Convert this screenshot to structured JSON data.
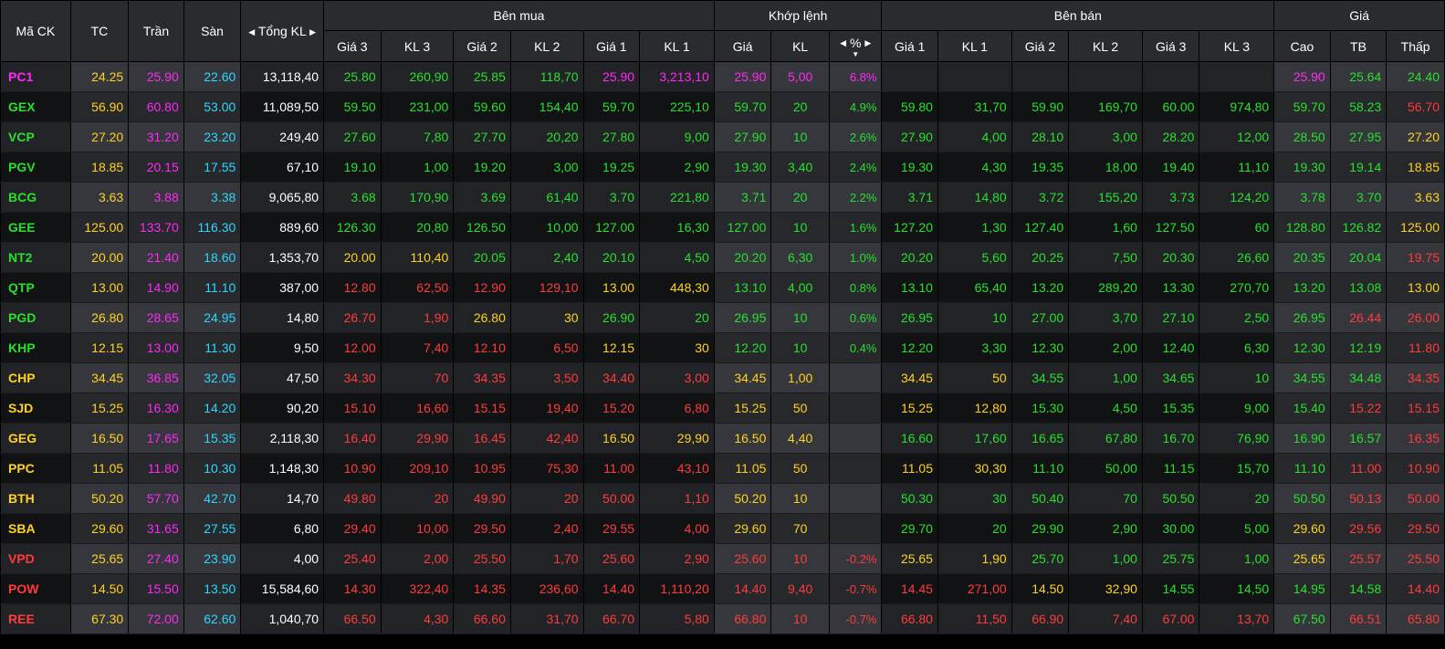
{
  "colors": {
    "up": "#28e02c",
    "down": "#ff3b3b",
    "reference": "#ffd21f",
    "ceiling": "#ff29f5",
    "floor": "#2ed7ff",
    "header_bg": "#2a2b2f"
  },
  "icons": {
    "prev": "◀",
    "next": "▶",
    "sort_desc": "▼",
    "prev_name": "triangle-left-icon",
    "next_name": "triangle-right-icon",
    "sort_name": "sort-desc-icon"
  },
  "header": {
    "symbol": "Mã CK",
    "ref": "TC",
    "ceil": "Trần",
    "floor": "Sàn",
    "total_vol": "Tổng KL",
    "groups": {
      "buy": "Bên mua",
      "match": "Khớp lệnh",
      "sell": "Bên bán",
      "price": "Giá"
    },
    "buy_cols": [
      "Giá 3",
      "KL 3",
      "Giá 2",
      "KL 2",
      "Giá 1",
      "KL 1"
    ],
    "match_cols": [
      "Giá",
      "KL",
      "%"
    ],
    "sell_cols": [
      "Giá 1",
      "KL 1",
      "Giá 2",
      "KL 2",
      "Giá 3",
      "KL 3"
    ],
    "price_cols": [
      "Cao",
      "TB",
      "Thấp"
    ]
  },
  "rows": [
    {
      "sym": "PC1",
      "ref": "24.25",
      "ceil": "25.90",
      "floor": "22.60",
      "total": "13,118,40",
      "b3p": "25.80",
      "b3v": "260,90",
      "b2p": "25.85",
      "b2v": "118,70",
      "b1p": "25.90",
      "b1v": "3,213,10",
      "mp": "25.90",
      "mv": "5,00",
      "pct": "6.8%",
      "s1p": "",
      "s1v": "",
      "s2p": "",
      "s2v": "",
      "s3p": "",
      "s3v": "",
      "hi": "25.90",
      "avg": "25.64",
      "lo": "24.40",
      "cls": {
        "sym": "ce",
        "b3p": "up",
        "b3v": "up",
        "b2p": "up",
        "b2v": "up",
        "b1p": "ce",
        "b1v": "ce",
        "mp": "ce",
        "mv": "ce",
        "pct": "ce",
        "s1p": "up",
        "s1v": "up",
        "s2p": "up",
        "s2v": "up",
        "s3p": "up",
        "s3v": "up",
        "hi": "ce",
        "avg": "up",
        "lo": "up"
      }
    },
    {
      "sym": "GEX",
      "ref": "56.90",
      "ceil": "60.80",
      "floor": "53.00",
      "total": "11,089,50",
      "b3p": "59.50",
      "b3v": "231,00",
      "b2p": "59.60",
      "b2v": "154,40",
      "b1p": "59.70",
      "b1v": "225,10",
      "mp": "59.70",
      "mv": "20",
      "pct": "4.9%",
      "s1p": "59.80",
      "s1v": "31,70",
      "s2p": "59.90",
      "s2v": "169,70",
      "s3p": "60.00",
      "s3v": "974,80",
      "hi": "59.70",
      "avg": "58.23",
      "lo": "56.70",
      "cls": {
        "sym": "up",
        "b3p": "up",
        "b3v": "up",
        "b2p": "up",
        "b2v": "up",
        "b1p": "up",
        "b1v": "up",
        "mp": "up",
        "mv": "up",
        "pct": "up",
        "s1p": "up",
        "s1v": "up",
        "s2p": "up",
        "s2v": "up",
        "s3p": "up",
        "s3v": "up",
        "hi": "up",
        "avg": "up",
        "lo": "dn"
      }
    },
    {
      "sym": "VCP",
      "ref": "27.20",
      "ceil": "31.20",
      "floor": "23.20",
      "total": "249,40",
      "b3p": "27.60",
      "b3v": "7,80",
      "b2p": "27.70",
      "b2v": "20,20",
      "b1p": "27.80",
      "b1v": "9,00",
      "mp": "27.90",
      "mv": "10",
      "pct": "2.6%",
      "s1p": "27.90",
      "s1v": "4,00",
      "s2p": "28.10",
      "s2v": "3,00",
      "s3p": "28.20",
      "s3v": "12,00",
      "hi": "28.50",
      "avg": "27.95",
      "lo": "27.20",
      "cls": {
        "sym": "up",
        "b3p": "up",
        "b3v": "up",
        "b2p": "up",
        "b2v": "up",
        "b1p": "up",
        "b1v": "up",
        "mp": "up",
        "mv": "up",
        "pct": "up",
        "s1p": "up",
        "s1v": "up",
        "s2p": "up",
        "s2v": "up",
        "s3p": "up",
        "s3v": "up",
        "hi": "up",
        "avg": "up",
        "lo": "ref"
      }
    },
    {
      "sym": "PGV",
      "ref": "18.85",
      "ceil": "20.15",
      "floor": "17.55",
      "total": "67,10",
      "b3p": "19.10",
      "b3v": "1,00",
      "b2p": "19.20",
      "b2v": "3,00",
      "b1p": "19.25",
      "b1v": "2,90",
      "mp": "19.30",
      "mv": "3,40",
      "pct": "2.4%",
      "s1p": "19.30",
      "s1v": "4,30",
      "s2p": "19.35",
      "s2v": "18,00",
      "s3p": "19.40",
      "s3v": "11,10",
      "hi": "19.30",
      "avg": "19.14",
      "lo": "18.85",
      "cls": {
        "sym": "up",
        "b3p": "up",
        "b3v": "up",
        "b2p": "up",
        "b2v": "up",
        "b1p": "up",
        "b1v": "up",
        "mp": "up",
        "mv": "up",
        "pct": "up",
        "s1p": "up",
        "s1v": "up",
        "s2p": "up",
        "s2v": "up",
        "s3p": "up",
        "s3v": "up",
        "hi": "up",
        "avg": "up",
        "lo": "ref"
      }
    },
    {
      "sym": "BCG",
      "ref": "3.63",
      "ceil": "3.88",
      "floor": "3.38",
      "total": "9,065,80",
      "b3p": "3.68",
      "b3v": "170,90",
      "b2p": "3.69",
      "b2v": "61,40",
      "b1p": "3.70",
      "b1v": "221,80",
      "mp": "3.71",
      "mv": "20",
      "pct": "2.2%",
      "s1p": "3.71",
      "s1v": "14,80",
      "s2p": "3.72",
      "s2v": "155,20",
      "s3p": "3.73",
      "s3v": "124,20",
      "hi": "3.78",
      "avg": "3.70",
      "lo": "3.63",
      "cls": {
        "sym": "up",
        "b3p": "up",
        "b3v": "up",
        "b2p": "up",
        "b2v": "up",
        "b1p": "up",
        "b1v": "up",
        "mp": "up",
        "mv": "up",
        "pct": "up",
        "s1p": "up",
        "s1v": "up",
        "s2p": "up",
        "s2v": "up",
        "s3p": "up",
        "s3v": "up",
        "hi": "up",
        "avg": "up",
        "lo": "ref"
      }
    },
    {
      "sym": "GEE",
      "ref": "125.00",
      "ceil": "133.70",
      "floor": "116.30",
      "total": "889,60",
      "b3p": "126.30",
      "b3v": "20,80",
      "b2p": "126.50",
      "b2v": "10,00",
      "b1p": "127.00",
      "b1v": "16,30",
      "mp": "127.00",
      "mv": "10",
      "pct": "1.6%",
      "s1p": "127.20",
      "s1v": "1,30",
      "s2p": "127.40",
      "s2v": "1,60",
      "s3p": "127.50",
      "s3v": "60",
      "hi": "128.80",
      "avg": "126.82",
      "lo": "125.00",
      "cls": {
        "sym": "up",
        "b3p": "up",
        "b3v": "up",
        "b2p": "up",
        "b2v": "up",
        "b1p": "up",
        "b1v": "up",
        "mp": "up",
        "mv": "up",
        "pct": "up",
        "s1p": "up",
        "s1v": "up",
        "s2p": "up",
        "s2v": "up",
        "s3p": "up",
        "s3v": "up",
        "hi": "up",
        "avg": "up",
        "lo": "ref"
      }
    },
    {
      "sym": "NT2",
      "ref": "20.00",
      "ceil": "21.40",
      "floor": "18.60",
      "total": "1,353,70",
      "b3p": "20.00",
      "b3v": "110,40",
      "b2p": "20.05",
      "b2v": "2,40",
      "b1p": "20.10",
      "b1v": "4,50",
      "mp": "20.20",
      "mv": "6,30",
      "pct": "1.0%",
      "s1p": "20.20",
      "s1v": "5,60",
      "s2p": "20.25",
      "s2v": "7,50",
      "s3p": "20.30",
      "s3v": "26,60",
      "hi": "20.35",
      "avg": "20.04",
      "lo": "19.75",
      "cls": {
        "sym": "up",
        "b3p": "ref",
        "b3v": "ref",
        "b2p": "up",
        "b2v": "up",
        "b1p": "up",
        "b1v": "up",
        "mp": "up",
        "mv": "up",
        "pct": "up",
        "s1p": "up",
        "s1v": "up",
        "s2p": "up",
        "s2v": "up",
        "s3p": "up",
        "s3v": "up",
        "hi": "up",
        "avg": "up",
        "lo": "dn"
      }
    },
    {
      "sym": "QTP",
      "ref": "13.00",
      "ceil": "14.90",
      "floor": "11.10",
      "total": "387,00",
      "b3p": "12.80",
      "b3v": "62,50",
      "b2p": "12.90",
      "b2v": "129,10",
      "b1p": "13.00",
      "b1v": "448,30",
      "mp": "13.10",
      "mv": "4,00",
      "pct": "0.8%",
      "s1p": "13.10",
      "s1v": "65,40",
      "s2p": "13.20",
      "s2v": "289,20",
      "s3p": "13.30",
      "s3v": "270,70",
      "hi": "13.20",
      "avg": "13.08",
      "lo": "13.00",
      "cls": {
        "sym": "up",
        "b3p": "dn",
        "b3v": "dn",
        "b2p": "dn",
        "b2v": "dn",
        "b1p": "ref",
        "b1v": "ref",
        "mp": "up",
        "mv": "up",
        "pct": "up",
        "s1p": "up",
        "s1v": "up",
        "s2p": "up",
        "s2v": "up",
        "s3p": "up",
        "s3v": "up",
        "hi": "up",
        "avg": "up",
        "lo": "ref"
      }
    },
    {
      "sym": "PGD",
      "ref": "26.80",
      "ceil": "28.65",
      "floor": "24.95",
      "total": "14,80",
      "b3p": "26.70",
      "b3v": "1,90",
      "b2p": "26.80",
      "b2v": "30",
      "b1p": "26.90",
      "b1v": "20",
      "mp": "26.95",
      "mv": "10",
      "pct": "0.6%",
      "s1p": "26.95",
      "s1v": "10",
      "s2p": "27.00",
      "s2v": "3,70",
      "s3p": "27.10",
      "s3v": "2,50",
      "hi": "26.95",
      "avg": "26.44",
      "lo": "26.00",
      "cls": {
        "sym": "up",
        "b3p": "dn",
        "b3v": "dn",
        "b2p": "ref",
        "b2v": "ref",
        "b1p": "up",
        "b1v": "up",
        "mp": "up",
        "mv": "up",
        "pct": "up",
        "s1p": "up",
        "s1v": "up",
        "s2p": "up",
        "s2v": "up",
        "s3p": "up",
        "s3v": "up",
        "hi": "up",
        "avg": "dn",
        "lo": "dn"
      }
    },
    {
      "sym": "KHP",
      "ref": "12.15",
      "ceil": "13.00",
      "floor": "11.30",
      "total": "9,50",
      "b3p": "12.00",
      "b3v": "7,40",
      "b2p": "12.10",
      "b2v": "6,50",
      "b1p": "12.15",
      "b1v": "30",
      "mp": "12.20",
      "mv": "10",
      "pct": "0.4%",
      "s1p": "12.20",
      "s1v": "3,30",
      "s2p": "12.30",
      "s2v": "2,00",
      "s3p": "12.40",
      "s3v": "6,30",
      "hi": "12.30",
      "avg": "12.19",
      "lo": "11.80",
      "cls": {
        "sym": "up",
        "b3p": "dn",
        "b3v": "dn",
        "b2p": "dn",
        "b2v": "dn",
        "b1p": "ref",
        "b1v": "ref",
        "mp": "up",
        "mv": "up",
        "pct": "up",
        "s1p": "up",
        "s1v": "up",
        "s2p": "up",
        "s2v": "up",
        "s3p": "up",
        "s3v": "up",
        "hi": "up",
        "avg": "up",
        "lo": "dn"
      }
    },
    {
      "sym": "CHP",
      "ref": "34.45",
      "ceil": "36.85",
      "floor": "32.05",
      "total": "47,50",
      "b3p": "34.30",
      "b3v": "70",
      "b2p": "34.35",
      "b2v": "3,50",
      "b1p": "34.40",
      "b1v": "3,00",
      "mp": "34.45",
      "mv": "1,00",
      "pct": "",
      "s1p": "34.45",
      "s1v": "50",
      "s2p": "34.55",
      "s2v": "1,00",
      "s3p": "34.65",
      "s3v": "10",
      "hi": "34.55",
      "avg": "34.48",
      "lo": "34.35",
      "cls": {
        "sym": "ref",
        "b3p": "dn",
        "b3v": "dn",
        "b2p": "dn",
        "b2v": "dn",
        "b1p": "dn",
        "b1v": "dn",
        "mp": "ref",
        "mv": "ref",
        "pct": "ref",
        "s1p": "ref",
        "s1v": "ref",
        "s2p": "up",
        "s2v": "up",
        "s3p": "up",
        "s3v": "up",
        "hi": "up",
        "avg": "up",
        "lo": "dn"
      }
    },
    {
      "sym": "SJD",
      "ref": "15.25",
      "ceil": "16.30",
      "floor": "14.20",
      "total": "90,20",
      "b3p": "15.10",
      "b3v": "16,60",
      "b2p": "15.15",
      "b2v": "19,40",
      "b1p": "15.20",
      "b1v": "6,80",
      "mp": "15.25",
      "mv": "50",
      "pct": "",
      "s1p": "15.25",
      "s1v": "12,80",
      "s2p": "15.30",
      "s2v": "4,50",
      "s3p": "15.35",
      "s3v": "9,00",
      "hi": "15.40",
      "avg": "15.22",
      "lo": "15.15",
      "cls": {
        "sym": "ref",
        "b3p": "dn",
        "b3v": "dn",
        "b2p": "dn",
        "b2v": "dn",
        "b1p": "dn",
        "b1v": "dn",
        "mp": "ref",
        "mv": "ref",
        "pct": "ref",
        "s1p": "ref",
        "s1v": "ref",
        "s2p": "up",
        "s2v": "up",
        "s3p": "up",
        "s3v": "up",
        "hi": "up",
        "avg": "dn",
        "lo": "dn"
      }
    },
    {
      "sym": "GEG",
      "ref": "16.50",
      "ceil": "17.65",
      "floor": "15.35",
      "total": "2,118,30",
      "b3p": "16.40",
      "b3v": "29,90",
      "b2p": "16.45",
      "b2v": "42,40",
      "b1p": "16.50",
      "b1v": "29,90",
      "mp": "16.50",
      "mv": "4,40",
      "pct": "",
      "s1p": "16.60",
      "s1v": "17,60",
      "s2p": "16.65",
      "s2v": "67,80",
      "s3p": "16.70",
      "s3v": "76,90",
      "hi": "16.90",
      "avg": "16.57",
      "lo": "16.35",
      "cls": {
        "sym": "ref",
        "b3p": "dn",
        "b3v": "dn",
        "b2p": "dn",
        "b2v": "dn",
        "b1p": "ref",
        "b1v": "ref",
        "mp": "ref",
        "mv": "ref",
        "pct": "ref",
        "s1p": "up",
        "s1v": "up",
        "s2p": "up",
        "s2v": "up",
        "s3p": "up",
        "s3v": "up",
        "hi": "up",
        "avg": "up",
        "lo": "dn"
      }
    },
    {
      "sym": "PPC",
      "ref": "11.05",
      "ceil": "11.80",
      "floor": "10.30",
      "total": "1,148,30",
      "b3p": "10.90",
      "b3v": "209,10",
      "b2p": "10.95",
      "b2v": "75,30",
      "b1p": "11.00",
      "b1v": "43,10",
      "mp": "11.05",
      "mv": "50",
      "pct": "",
      "s1p": "11.05",
      "s1v": "30,30",
      "s2p": "11.10",
      "s2v": "50,00",
      "s3p": "11.15",
      "s3v": "15,70",
      "hi": "11.10",
      "avg": "11.00",
      "lo": "10.90",
      "cls": {
        "sym": "ref",
        "b3p": "dn",
        "b3v": "dn",
        "b2p": "dn",
        "b2v": "dn",
        "b1p": "dn",
        "b1v": "dn",
        "mp": "ref",
        "mv": "ref",
        "pct": "ref",
        "s1p": "ref",
        "s1v": "ref",
        "s2p": "up",
        "s2v": "up",
        "s3p": "up",
        "s3v": "up",
        "hi": "up",
        "avg": "dn",
        "lo": "dn"
      }
    },
    {
      "sym": "BTH",
      "ref": "50.20",
      "ceil": "57.70",
      "floor": "42.70",
      "total": "14,70",
      "b3p": "49.80",
      "b3v": "20",
      "b2p": "49.90",
      "b2v": "20",
      "b1p": "50.00",
      "b1v": "1,10",
      "mp": "50.20",
      "mv": "10",
      "pct": "",
      "s1p": "50.30",
      "s1v": "30",
      "s2p": "50.40",
      "s2v": "70",
      "s3p": "50.50",
      "s3v": "20",
      "hi": "50.50",
      "avg": "50.13",
      "lo": "50.00",
      "cls": {
        "sym": "ref",
        "b3p": "dn",
        "b3v": "dn",
        "b2p": "dn",
        "b2v": "dn",
        "b1p": "dn",
        "b1v": "dn",
        "mp": "ref",
        "mv": "ref",
        "pct": "ref",
        "s1p": "up",
        "s1v": "up",
        "s2p": "up",
        "s2v": "up",
        "s3p": "up",
        "s3v": "up",
        "hi": "up",
        "avg": "dn",
        "lo": "dn"
      }
    },
    {
      "sym": "SBA",
      "ref": "29.60",
      "ceil": "31.65",
      "floor": "27.55",
      "total": "6,80",
      "b3p": "29.40",
      "b3v": "10,00",
      "b2p": "29.50",
      "b2v": "2,40",
      "b1p": "29.55",
      "b1v": "4,00",
      "mp": "29.60",
      "mv": "70",
      "pct": "",
      "s1p": "29.70",
      "s1v": "20",
      "s2p": "29.90",
      "s2v": "2,90",
      "s3p": "30.00",
      "s3v": "5,00",
      "hi": "29.60",
      "avg": "29.56",
      "lo": "29.50",
      "cls": {
        "sym": "ref",
        "b3p": "dn",
        "b3v": "dn",
        "b2p": "dn",
        "b2v": "dn",
        "b1p": "dn",
        "b1v": "dn",
        "mp": "ref",
        "mv": "ref",
        "pct": "ref",
        "s1p": "up",
        "s1v": "up",
        "s2p": "up",
        "s2v": "up",
        "s3p": "up",
        "s3v": "up",
        "hi": "ref",
        "avg": "dn",
        "lo": "dn"
      }
    },
    {
      "sym": "VPD",
      "ref": "25.65",
      "ceil": "27.40",
      "floor": "23.90",
      "total": "4,00",
      "b3p": "25.40",
      "b3v": "2,00",
      "b2p": "25.50",
      "b2v": "1,70",
      "b1p": "25.60",
      "b1v": "2,90",
      "mp": "25.60",
      "mv": "10",
      "pct": "-0.2%",
      "s1p": "25.65",
      "s1v": "1,90",
      "s2p": "25.70",
      "s2v": "1,00",
      "s3p": "25.75",
      "s3v": "1,00",
      "hi": "25.65",
      "avg": "25.57",
      "lo": "25.50",
      "cls": {
        "sym": "dn",
        "b3p": "dn",
        "b3v": "dn",
        "b2p": "dn",
        "b2v": "dn",
        "b1p": "dn",
        "b1v": "dn",
        "mp": "dn",
        "mv": "dn",
        "pct": "dn",
        "s1p": "ref",
        "s1v": "ref",
        "s2p": "up",
        "s2v": "up",
        "s3p": "up",
        "s3v": "up",
        "hi": "ref",
        "avg": "dn",
        "lo": "dn"
      }
    },
    {
      "sym": "POW",
      "ref": "14.50",
      "ceil": "15.50",
      "floor": "13.50",
      "total": "15,584,60",
      "b3p": "14.30",
      "b3v": "322,40",
      "b2p": "14.35",
      "b2v": "236,60",
      "b1p": "14.40",
      "b1v": "1,110,20",
      "mp": "14.40",
      "mv": "9,40",
      "pct": "-0.7%",
      "s1p": "14.45",
      "s1v": "271,00",
      "s2p": "14.50",
      "s2v": "32,90",
      "s3p": "14.55",
      "s3v": "14,50",
      "hi": "14.95",
      "avg": "14.58",
      "lo": "14.40",
      "cls": {
        "sym": "dn",
        "b3p": "dn",
        "b3v": "dn",
        "b2p": "dn",
        "b2v": "dn",
        "b1p": "dn",
        "b1v": "dn",
        "mp": "dn",
        "mv": "dn",
        "pct": "dn",
        "s1p": "dn",
        "s1v": "dn",
        "s2p": "ref",
        "s2v": "ref",
        "s3p": "up",
        "s3v": "up",
        "hi": "up",
        "avg": "up",
        "lo": "dn"
      }
    },
    {
      "sym": "REE",
      "ref": "67.30",
      "ceil": "72.00",
      "floor": "62.60",
      "total": "1,040,70",
      "b3p": "66.50",
      "b3v": "4,30",
      "b2p": "66.60",
      "b2v": "31,70",
      "b1p": "66.70",
      "b1v": "5,80",
      "mp": "66.80",
      "mv": "10",
      "pct": "-0.7%",
      "s1p": "66.80",
      "s1v": "11,50",
      "s2p": "66.90",
      "s2v": "7,40",
      "s3p": "67.00",
      "s3v": "13,70",
      "hi": "67.50",
      "avg": "66.51",
      "lo": "65.80",
      "cls": {
        "sym": "dn",
        "b3p": "dn",
        "b3v": "dn",
        "b2p": "dn",
        "b2v": "dn",
        "b1p": "dn",
        "b1v": "dn",
        "mp": "dn",
        "mv": "dn",
        "pct": "dn",
        "s1p": "dn",
        "s1v": "dn",
        "s2p": "dn",
        "s2v": "dn",
        "s3p": "dn",
        "s3v": "dn",
        "hi": "up",
        "avg": "dn",
        "lo": "dn"
      }
    }
  ]
}
